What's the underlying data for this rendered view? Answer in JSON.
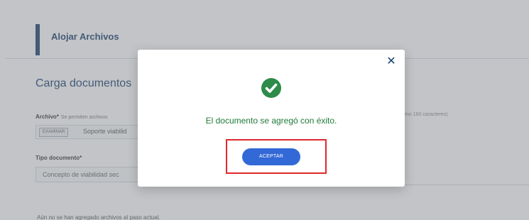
{
  "header": {
    "title": "Alojar Archivos"
  },
  "form": {
    "section_title": "Carga documentos",
    "file_label": "Archivo*",
    "file_hint": "Se permiten archivos",
    "examine_button": "EXAMINAR",
    "file_value": "Soporte viabilid",
    "doc_type_label": "Tipo documento*",
    "doc_type_value": "Concepto de viabilidad sec",
    "right_hint": "mo 160 caracteres)",
    "footnote": "Aún no se han agregado archivos al paso actual."
  },
  "modal": {
    "close_glyph": "✕",
    "message": "El documento se agregó con éxito.",
    "accept_label": "ACEPTAR",
    "success_color": "#2e8b4a",
    "accent_color": "#3369d6",
    "highlight_color": "#e0282e",
    "icon": "check-circle-icon"
  }
}
